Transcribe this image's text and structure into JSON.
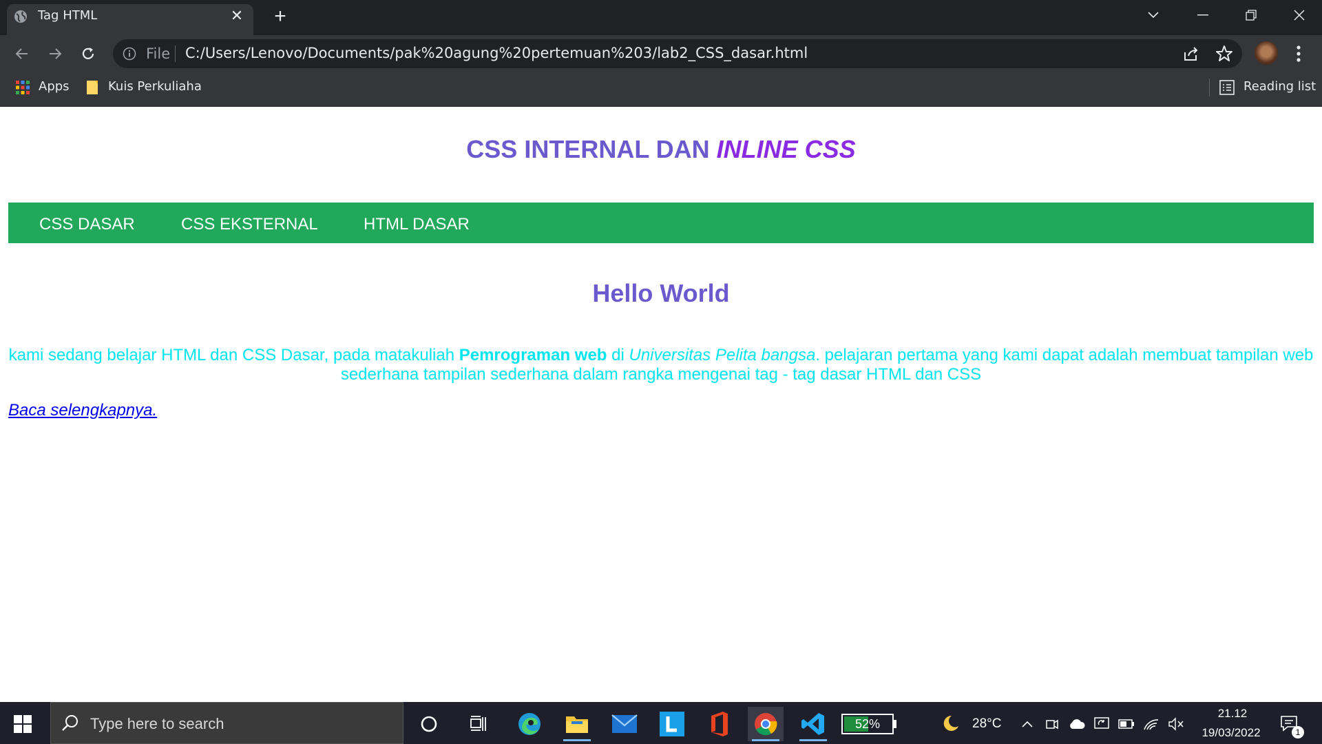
{
  "browser": {
    "tab_title": "Tag HTML",
    "tab_close": "✕",
    "new_tab": "+",
    "file_label": "File",
    "url": "C:/Users/Lenovo/Documents/pak%20agung%20pertemuan%203/lab2_CSS_dasar.html",
    "bookmarks": [
      {
        "label": "Apps",
        "icon": "apps-grid-icon"
      },
      {
        "label": "Kuis Perkuliaha",
        "icon": "folder-icon"
      }
    ],
    "reading_list": "Reading list"
  },
  "page": {
    "heading_part1": "CSS INTERNAL DAN ",
    "heading_part2": "INLINE CSS",
    "nav": [
      "CSS DASAR",
      "CSS EKSTERNAL",
      "HTML DASAR"
    ],
    "subheading": "Hello World",
    "para_1": "kami sedang belajar HTML dan CSS Dasar, pada matakuliah ",
    "para_bold": "Pemrograman web",
    "para_2": " di ",
    "para_italic": "Universitas Pelita bangsa",
    "para_3": ". pelajaran pertama yang kami dapat adalah membuat tampilan web sederhana tampilan sederhana dalam rangka mengenai tag - tag dasar HTML dan CSS",
    "read_more": "Baca selengkapnya."
  },
  "taskbar": {
    "search_placeholder": "Type here to search",
    "battery_percent": "52%",
    "battery_level": 0.52,
    "temperature": "28°C",
    "time": "21.12",
    "date": "19/03/2022",
    "notification_count": "1"
  },
  "colors": {
    "heading": "#6a5acd",
    "heading_italic": "#8a2be2",
    "navbar": "#22a85a",
    "paragraph": "#00e5ee",
    "link": "#0000ee"
  }
}
